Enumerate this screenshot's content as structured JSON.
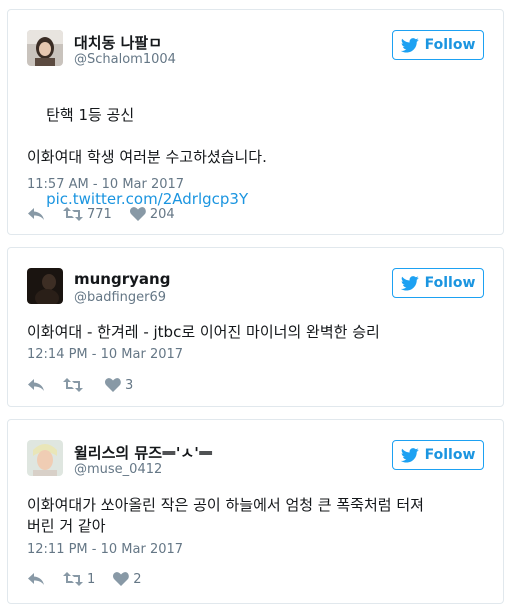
{
  "tweets": [
    {
      "name": "대치동 나팔ㅁ",
      "handle": "@Schalom1004",
      "follow_label": "Follow",
      "text": "탄핵 1등 공신\n\n이화여대 학생 여러분 수고하셨습니다.",
      "link": "pic.twitter.com/2Adrlgcp3Y",
      "time": "11:57 AM - 10 Mar 2017",
      "retweets": "771",
      "likes": "204"
    },
    {
      "name": "mungryang",
      "handle": "@badfinger69",
      "follow_label": "Follow",
      "text": "이화여대 - 한겨레 - jtbc로 이어진 마이너의 완벽한 승리",
      "time": "12:14 PM - 10 Mar 2017",
      "retweets": "",
      "likes": "3"
    },
    {
      "name": "윌리스의 뮤즈ᆖ'ㅅ'ᆖ",
      "handle": "@muse_0412",
      "follow_label": "Follow",
      "text": "이화여대가 쏘아올린 작은 공이 하늘에서 엄청 큰 폭죽처럼 터져\n버린 거 같아",
      "time": "12:11 PM - 10 Mar 2017",
      "retweets": "1",
      "likes": "2"
    }
  ],
  "icons": {
    "reply": "reply-icon",
    "retweet": "retweet-icon",
    "like": "heart-icon",
    "follow": "twitter-bird-icon"
  },
  "colors": {
    "accent": "#1da1f2",
    "link": "#1b95e0",
    "muted": "#657786",
    "icon": "#8899a6"
  }
}
